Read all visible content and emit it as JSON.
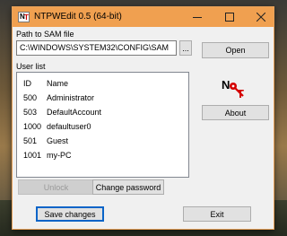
{
  "window": {
    "title": "NTPWEdit 0.5 (64-bit)",
    "controls": {
      "minimize": "—",
      "maximize": "☐",
      "close": "✕"
    }
  },
  "path": {
    "label": "Path to SAM file",
    "value": "C:\\WINDOWS\\SYSTEM32\\CONFIG\\SAM",
    "browse_label": "...",
    "open_label": "Open"
  },
  "user_list": {
    "label": "User list",
    "headers": {
      "id": "ID",
      "name": "Name"
    },
    "rows": [
      {
        "id": "500",
        "name": "Administrator"
      },
      {
        "id": "503",
        "name": "DefaultAccount"
      },
      {
        "id": "1000",
        "name": "defaultuser0"
      },
      {
        "id": "501",
        "name": "Guest"
      },
      {
        "id": "1001",
        "name": "my-PC"
      }
    ]
  },
  "buttons": {
    "about": "About",
    "unlock": "Unlock",
    "change_password": "Change password",
    "save_changes": "Save changes",
    "exit": "Exit"
  },
  "logo": {
    "letters": "NT",
    "icon": "key-icon"
  },
  "colors": {
    "titlebar": "#f0a050",
    "logo_red": "#d40000",
    "accent": "#0a64c8"
  }
}
